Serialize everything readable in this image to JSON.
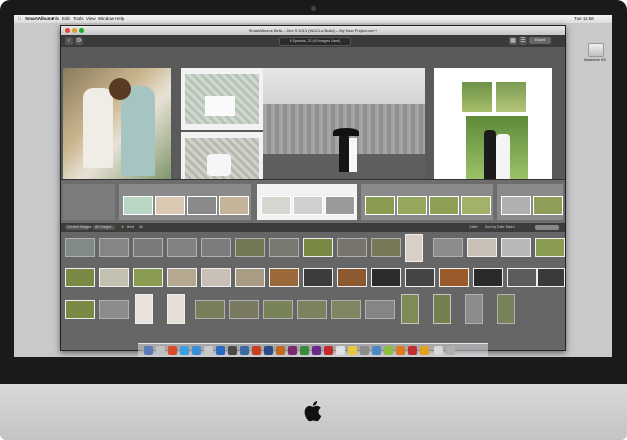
{
  "menubar": {
    "app_name": "SmartAlbums",
    "menus": [
      "File",
      "Edit",
      "Tools",
      "View",
      "Window",
      "Help"
    ],
    "clock": "Tue 11:56"
  },
  "desktop": {
    "hd_label": "Macintosh HD"
  },
  "window": {
    "title": "SmartAlbums Beta – Dec 9 2013 (WUCLa Build) – My New Project.sa++",
    "spread_select": "6 Spreads, 22 (90 Images Used)",
    "export_label": "Export"
  },
  "filterbar": {
    "unused_label": "Unused Images",
    "all_images_label": "All Images",
    "star_label": "Best",
    "all_label": "All",
    "other_label": "Other",
    "sort_label": "Sort by Date Taken"
  },
  "colors": {
    "app_bg": "#4d4d4d",
    "workarea_bg": "#5a5a5a",
    "filmstrip_bg": "#6d6d6d",
    "grid_bg": "#666666",
    "green_photo": "#7a8a45",
    "selected_spread": "#f2f2f2"
  },
  "icons": [
    "apple-icon",
    "camera-icon",
    "hard-drive-icon",
    "back-icon",
    "gear-icon",
    "grid-view-icon",
    "list-view-icon",
    "star-icon",
    "slider-icon"
  ]
}
